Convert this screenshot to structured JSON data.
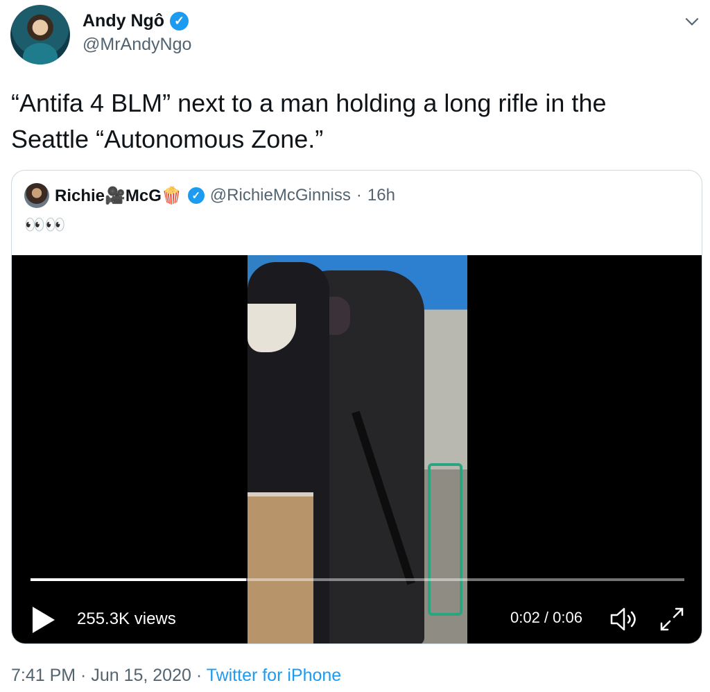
{
  "author": {
    "name": "Andy Ngô",
    "verified_glyph": "✓",
    "handle": "@MrAndyNgo"
  },
  "tweet": {
    "text_line1": "“Antifa 4 BLM” next to a man holding a long rifle in the",
    "text_line2": "Seattle “Autonomous Zone.”"
  },
  "quoted": {
    "name": "Richie🎥McG🍿",
    "verified_glyph": "✓",
    "handle": "@RichieMcGinniss",
    "separator": "·",
    "time": "16h",
    "text": "👀👀"
  },
  "video": {
    "progress": 0.33,
    "views": "255.3K views",
    "timecode": "0:02 / 0:06"
  },
  "meta": {
    "time": "7:41 PM",
    "sep1": " · ",
    "date": "Jun 15, 2020",
    "sep2": " · ",
    "source": "Twitter for iPhone"
  },
  "icons": {
    "menu": "chevron-down-icon",
    "play": "play-icon",
    "volume": "volume-icon",
    "fullscreen": "fullscreen-icon"
  },
  "colors": {
    "accent": "#1d9bf0",
    "secondary_text": "#536471",
    "border": "#cfd9de"
  }
}
